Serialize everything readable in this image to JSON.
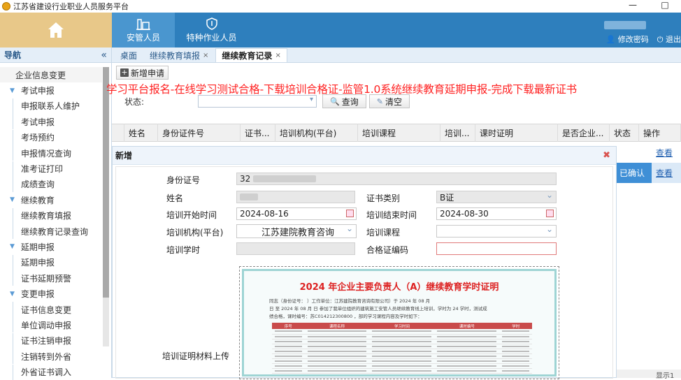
{
  "window": {
    "title": "江苏省建设行业职业人员服务平台",
    "controls": [
      "—",
      "□"
    ]
  },
  "header": {
    "nav": [
      {
        "label": "安管人员",
        "active": true
      },
      {
        "label": "特种作业人员",
        "active": false
      }
    ],
    "links": {
      "change_password": "修改密码",
      "logout": "退出"
    },
    "colors": {
      "primary": "#2e7fbd",
      "home_bg": "#e8c889"
    }
  },
  "sidebar": {
    "title": "导航",
    "collapse_icon": "«",
    "items": [
      {
        "type": "top",
        "label": "企业信息变更"
      },
      {
        "type": "group",
        "label": "考试申报"
      },
      {
        "type": "sub",
        "label": "申报联系人维护"
      },
      {
        "type": "sub",
        "label": "考试申报"
      },
      {
        "type": "sub",
        "label": "考场预约"
      },
      {
        "type": "sub",
        "label": "申报情况查询"
      },
      {
        "type": "sub",
        "label": "准考证打印"
      },
      {
        "type": "sub",
        "label": "成绩查询"
      },
      {
        "type": "group",
        "label": "继续教育"
      },
      {
        "type": "sub",
        "label": "继续教育填报"
      },
      {
        "type": "sub",
        "label": "继续教育记录查询"
      },
      {
        "type": "group",
        "label": "延期申报"
      },
      {
        "type": "sub",
        "label": "延期申报"
      },
      {
        "type": "sub",
        "label": "证书延期预警"
      },
      {
        "type": "group",
        "label": "变更申报"
      },
      {
        "type": "sub",
        "label": "证书信息变更"
      },
      {
        "type": "sub",
        "label": "单位调动申报"
      },
      {
        "type": "sub",
        "label": "证书注销申报"
      },
      {
        "type": "sub",
        "label": "注销转到外省"
      },
      {
        "type": "sub",
        "label": "外省证书调入"
      }
    ]
  },
  "tabs": [
    {
      "label": "桌面",
      "closable": false,
      "active": false
    },
    {
      "label": "继续教育填报",
      "closable": true,
      "active": false
    },
    {
      "label": "继续教育记录",
      "closable": true,
      "active": true
    }
  ],
  "toolbar": {
    "add_label": "新增申请",
    "banner": "学习平台报名-在线学习测试合格-下载培训合格证-监管1.0系统继续教育延期申报-完成下载最新证书",
    "status_label": "状态:",
    "status_value": "",
    "query_label": "查询",
    "clear_label": "清空"
  },
  "grid": {
    "columns": [
      "",
      "姓名",
      "身份证件号",
      "证书...",
      "培训机构(平台)",
      "培训课程",
      "培训...",
      "课时证明",
      "是否企业...",
      "状态",
      "操作"
    ],
    "rows": [
      {
        "status": "",
        "action": "查看"
      },
      {
        "status": "已确认",
        "action": "查看"
      }
    ],
    "footer": "显示1"
  },
  "dialog": {
    "title": "新增",
    "close_icon": "✖",
    "fields": {
      "id_label": "身份证号",
      "id_value": "32",
      "name_label": "姓名",
      "name_value": "",
      "cert_type_label": "证书类别",
      "cert_type_value": "B证",
      "start_label": "培训开始时间",
      "start_value": "2024-08-16",
      "end_label": "培训结束时间",
      "end_value": "2024-08-30",
      "org_label": "培训机构(平台)",
      "org_value": "江苏建院教育咨询",
      "course_label": "培训课程",
      "course_value": "",
      "hours_label": "培训学时",
      "hours_value": "",
      "certno_label": "合格证编码",
      "certno_value": "",
      "upload_label": "培训证明材料上传"
    },
    "certificate": {
      "title": "2024 年企业主要负责人（A）继续教育学时证明",
      "text_line1": "同志（身份证号：         ）工作单位：江苏建院教育咨询有限公司）于 2024 年 08 月",
      "text_line2": "日 至 2024 年 08 月   日 参加了我单位组织的建筑施工安管人员继续教育线上培训，学时为 24 学时，测试成",
      "text_line3": "绩合格，课时编号：苏C014212300800    ，部的学习课程内容及学时如下：",
      "table_headers": [
        "序号",
        "课程名称",
        "学习时间",
        "课时编号",
        "学时"
      ]
    }
  }
}
